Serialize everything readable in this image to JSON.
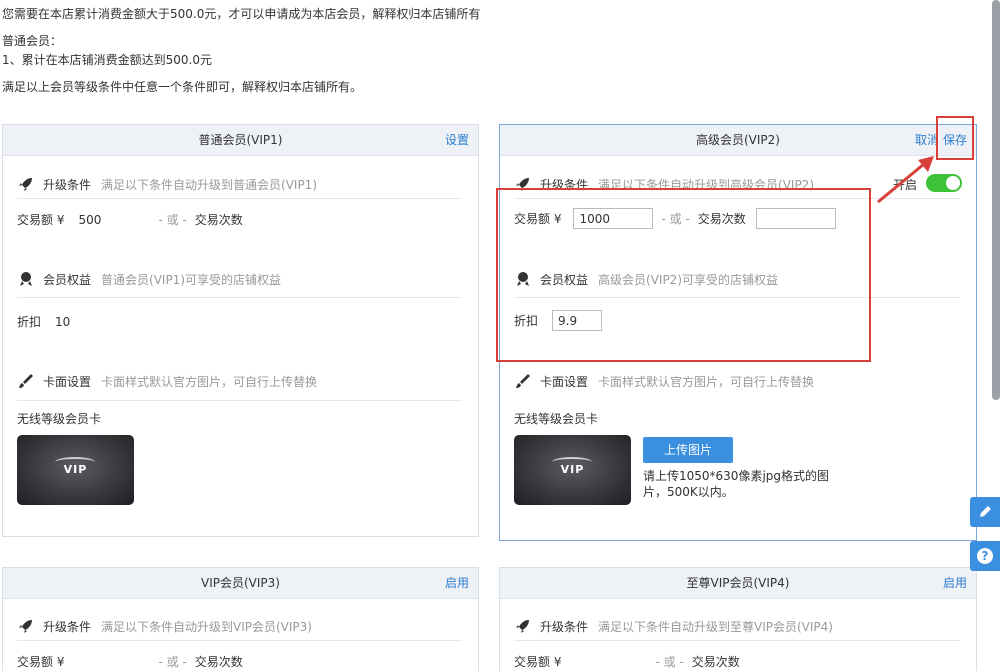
{
  "intro": {
    "line1": "您需要在本店累计消费金额大于500.0元，才可以申请成为本店会员，解释权归本店铺所有",
    "line2": "普通会员：",
    "line3": "1、累计在本店铺消费金额达到500.0元",
    "line4": "满足以上会员等级条件中任意一个条件即可，解释权归本店铺所有。"
  },
  "common": {
    "upgrade_label": "升级条件",
    "benefit_label": "会员权益",
    "face_label": "卡面设置",
    "face_desc": "卡面样式默认官方图片，可自行上传替换",
    "trade_amount": "交易额 ¥",
    "or": "- 或 -",
    "trade_count": "交易次数",
    "discount": "折扣",
    "wireless_card": "无线等级会员卡",
    "vip_text": "VIP"
  },
  "vip1": {
    "title": "普通会员(VIP1)",
    "action": "设置",
    "upgrade_desc": "满足以下条件自动升级到普通会员(VIP1)",
    "benefit_desc": "普通会员(VIP1)可享受的店铺权益",
    "amount": "500",
    "discount": "10"
  },
  "vip2": {
    "title": "高级会员(VIP2)",
    "cancel": "取消",
    "save": "保存",
    "upgrade_desc": "满足以下条件自动升级到高级会员(VIP2)",
    "toggle_label": "开启",
    "benefit_desc": "高级会员(VIP2)可享受的店铺权益",
    "amount": "1000",
    "count": "",
    "discount": "9.9",
    "upload": "上传图片",
    "upload_hint": "请上传1050*630像素jpg格式的图片，500K以内。"
  },
  "vip3": {
    "title": "VIP会员(VIP3)",
    "action": "启用",
    "upgrade_desc": "满足以下条件自动升级到VIP会员(VIP3)"
  },
  "vip4": {
    "title": "至尊VIP会员(VIP4)",
    "action": "启用",
    "upgrade_desc": "满足以下条件自动升级到至尊VIP会员(VIP4)"
  },
  "colors": {
    "accent": "#2d7fd1",
    "toggle_on": "#3ec23a",
    "highlight": "#d9403a"
  }
}
